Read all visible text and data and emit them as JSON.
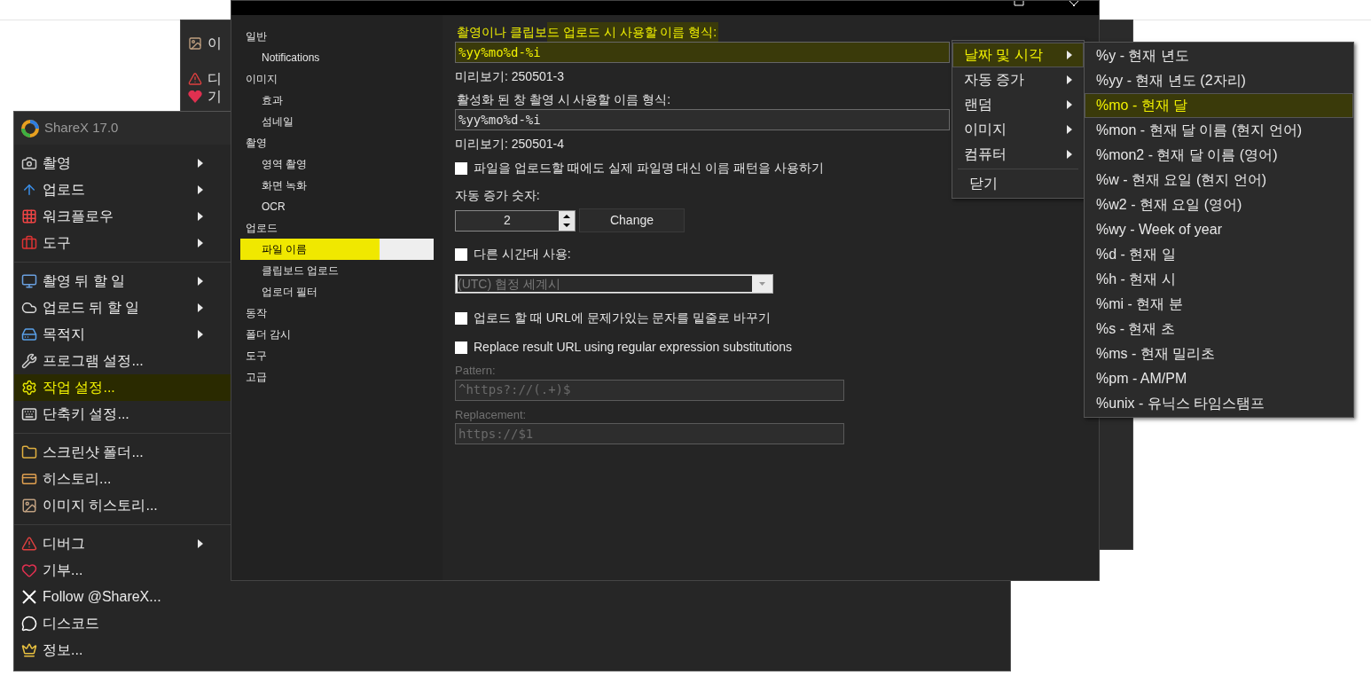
{
  "background_window": {
    "items": [
      {
        "label": "이"
      },
      {
        "label": "디"
      },
      {
        "label": "기"
      }
    ]
  },
  "tray_menu": {
    "title": "ShareX 17.0",
    "groups": [
      [
        {
          "label": "촬영",
          "submenu": true,
          "highlighted": false
        },
        {
          "label": "업로드",
          "submenu": true,
          "highlighted": false
        },
        {
          "label": "워크플로우",
          "submenu": true,
          "highlighted": false
        },
        {
          "label": "도구",
          "submenu": true,
          "highlighted": false
        }
      ],
      [
        {
          "label": "촬영 뒤 할 일",
          "submenu": true,
          "highlighted": false
        },
        {
          "label": "업로드 뒤 할 일",
          "submenu": true,
          "highlighted": false
        },
        {
          "label": "목적지",
          "submenu": true,
          "highlighted": false
        },
        {
          "label": "프로그램 설정...",
          "submenu": false,
          "highlighted": false
        },
        {
          "label": "작업 설정...",
          "submenu": false,
          "highlighted": true
        },
        {
          "label": "단축키 설정...",
          "submenu": false,
          "highlighted": false
        }
      ],
      [
        {
          "label": "스크린샷 폴더...",
          "submenu": false,
          "highlighted": false
        },
        {
          "label": "히스토리...",
          "submenu": false,
          "highlighted": false
        },
        {
          "label": "이미지 히스토리...",
          "submenu": false,
          "highlighted": false
        }
      ],
      [
        {
          "label": "디버그",
          "submenu": true,
          "highlighted": false
        },
        {
          "label": "기부...",
          "submenu": false,
          "highlighted": false
        },
        {
          "label": "Follow @ShareX...",
          "submenu": false,
          "highlighted": false
        },
        {
          "label": "디스코드",
          "submenu": false,
          "highlighted": false
        },
        {
          "label": "정보...",
          "submenu": false,
          "highlighted": false
        }
      ]
    ]
  },
  "settings": {
    "nav": [
      {
        "label": "일반",
        "selected": false,
        "children": [
          {
            "label": "Notifications",
            "selected": false
          }
        ]
      },
      {
        "label": "이미지",
        "selected": false,
        "children": [
          {
            "label": "효과",
            "selected": false
          },
          {
            "label": "섬네일",
            "selected": false
          }
        ]
      },
      {
        "label": "촬영",
        "selected": false,
        "children": [
          {
            "label": "영역 촬영",
            "selected": false
          },
          {
            "label": "화면 녹화",
            "selected": false
          },
          {
            "label": "OCR",
            "selected": false
          }
        ]
      },
      {
        "label": "업로드",
        "selected": false,
        "children": [
          {
            "label": "파일 이름",
            "selected": true
          },
          {
            "label": "클립보드 업로드",
            "selected": false
          },
          {
            "label": "업로더 필터",
            "selected": false
          }
        ]
      },
      {
        "label": "동작",
        "selected": false
      },
      {
        "label": "폴더 감시",
        "selected": false
      },
      {
        "label": "도구",
        "selected": false
      },
      {
        "label": "고급",
        "selected": false
      }
    ],
    "name_format": {
      "label": "촬영이나 클립보드 업로드 시 사용할 이름 형식:",
      "value": "%yy%mo%d-%i",
      "highlighted": true,
      "preview": "미리보기: 250501-3"
    },
    "window_name_format": {
      "label": "활성화 된 창 촬영 시 사용할 이름 형식:",
      "value": "%yy%mo%d-%i",
      "highlighted": false,
      "preview": "미리보기: 250501-4"
    },
    "use_pattern_checkbox": {
      "label": "파일을 업로드할 때에도 실제 파일명 대신 이름 패턴을 사용하기",
      "checked": false
    },
    "auto_increment": {
      "label": "자동 증가 숫자:",
      "value": "2",
      "button": "Change"
    },
    "timezone_checkbox": {
      "label": "다른 시간대 사용:",
      "checked": false
    },
    "timezone_select": {
      "value": "(UTC) 협정 세계시",
      "disabled": true
    },
    "url_underscore_checkbox": {
      "label": "업로드 할 때 URL에 문제가있는 문자를 밑줄로 바꾸기",
      "checked": false
    },
    "regex_checkbox": {
      "label": "Replace result URL using regular expression substitutions",
      "checked": false
    },
    "pattern": {
      "label": "Pattern:",
      "value": "^https?://(.+)$",
      "disabled": true
    },
    "replacement": {
      "label": "Replacement:",
      "value": "https://$1",
      "disabled": true
    }
  },
  "context_menu": {
    "groups": [
      [
        {
          "label": "날짜 및 시각",
          "submenu": true,
          "highlighted": true
        },
        {
          "label": "자동 증가",
          "submenu": true,
          "highlighted": false
        },
        {
          "label": "랜덤",
          "submenu": true,
          "highlighted": false
        },
        {
          "label": "이미지",
          "submenu": true,
          "highlighted": false
        },
        {
          "label": "컴퓨터",
          "submenu": true,
          "highlighted": false
        }
      ],
      [
        {
          "label": "닫기",
          "submenu": false,
          "highlighted": false
        }
      ]
    ]
  },
  "submenu": {
    "items": [
      {
        "label": "%y - 현재 년도",
        "highlighted": false
      },
      {
        "label": "%yy - 현재 년도 (2자리)",
        "highlighted": false
      },
      {
        "label": "%mo - 현재 달",
        "highlighted": true
      },
      {
        "label": "%mon - 현재 달 이름 (현지 언어)",
        "highlighted": false
      },
      {
        "label": "%mon2 - 현재 달 이름 (영어)",
        "highlighted": false
      },
      {
        "label": "%w - 현재 요일 (현지 언어)",
        "highlighted": false
      },
      {
        "label": "%w2 - 현재 요일 (영어)",
        "highlighted": false
      },
      {
        "label": "%wy - Week of year",
        "highlighted": false
      },
      {
        "label": "%d - 현재 일",
        "highlighted": false
      },
      {
        "label": "%h - 현재 시",
        "highlighted": false
      },
      {
        "label": "%mi - 현재 분",
        "highlighted": false
      },
      {
        "label": "%s - 현재 초",
        "highlighted": false
      },
      {
        "label": "%ms - 현재 밀리초",
        "highlighted": false
      },
      {
        "label": "%pm - AM/PM",
        "highlighted": false
      },
      {
        "label": "%unix - 유닉스 타임스탬프",
        "highlighted": false
      }
    ]
  }
}
